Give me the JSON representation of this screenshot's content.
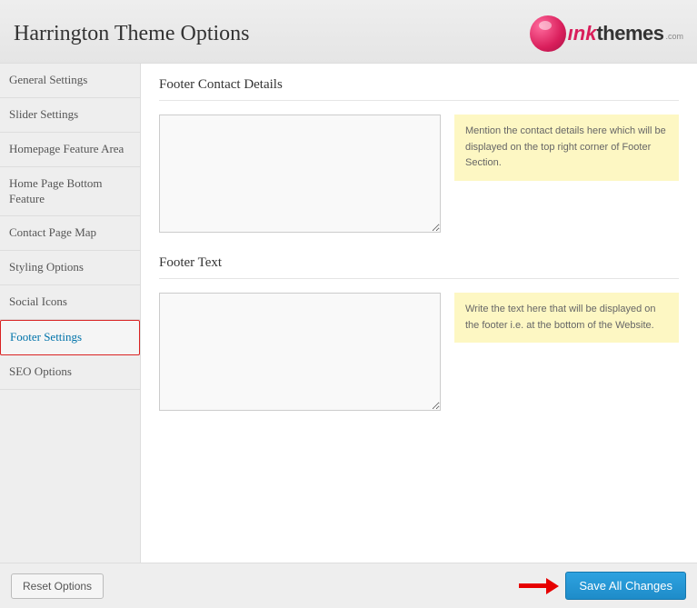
{
  "header": {
    "title": "Harrington Theme Options",
    "logo_ink": "ınk",
    "logo_themes": "themes",
    "logo_com": ".com"
  },
  "sidebar": {
    "items": [
      {
        "label": "General Settings",
        "active": false
      },
      {
        "label": "Slider Settings",
        "active": false
      },
      {
        "label": "Homepage Feature Area",
        "active": false
      },
      {
        "label": "Home Page Bottom Feature",
        "active": false
      },
      {
        "label": "Contact Page Map",
        "active": false
      },
      {
        "label": "Styling Options",
        "active": false
      },
      {
        "label": "Social Icons",
        "active": false
      },
      {
        "label": "Footer Settings",
        "active": true
      },
      {
        "label": "SEO Options",
        "active": false
      }
    ]
  },
  "main": {
    "sections": [
      {
        "title": "Footer Contact Details",
        "value": "",
        "help": "Mention the contact details here which will be displayed on the top right corner of Footer Section."
      },
      {
        "title": "Footer Text",
        "value": "",
        "help": "Write the text here that will be displayed on the footer i.e. at the bottom of the Website."
      }
    ]
  },
  "footer": {
    "reset_label": "Reset Options",
    "save_label": "Save All Changes"
  }
}
